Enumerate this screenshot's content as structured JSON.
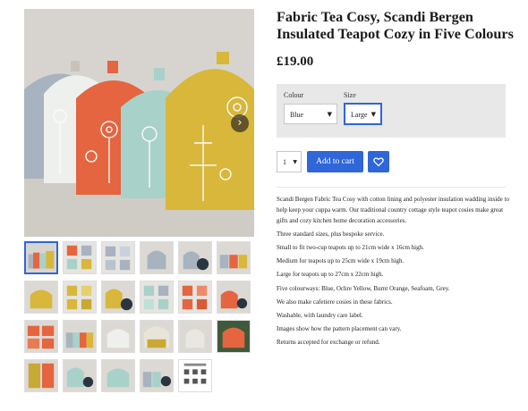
{
  "product": {
    "title": "Fabric Tea Cosy, Scandi Bergen Insulated Teapot Cozy in Five Colours",
    "price": "£19.00"
  },
  "options": {
    "colour_label": "Colour",
    "colour_value": "Blue",
    "size_label": "Size",
    "size_value": "Large"
  },
  "cart": {
    "quantity": "1",
    "add_label": "Add to cart"
  },
  "gallery": {
    "thumbnail_count": 23,
    "active_index": 0
  },
  "description": [
    "Scandi Bergen Fabric Tea Cosy with cotton lining and polyester insulation wadding inside to help keep your cuppa warm. Our traditional country cottage style teapot cosies make great gifts and cozy kitchen home decoration accessories.",
    "Three standard sizes, plus bespoke service.",
    "Small to fit two-cup teapots up to 21cm wide x 16cm high.",
    "Medium for teapots up to 25cm wide x 19cm high.",
    "Large for teapots up to 27cm x 22cm high.",
    "Five colourways: Blue, Ochre Yellow, Burnt Orange, Seafoam, Grey.",
    "We also make cafetiere cosies in these fabrics.",
    "Washable, with laundry care label.",
    "Images show how the pattern placement can vary.",
    "Returns accepted for exchange or refund."
  ],
  "colors": {
    "accent": "#2f66d9",
    "panel": "#e8e8e8"
  }
}
